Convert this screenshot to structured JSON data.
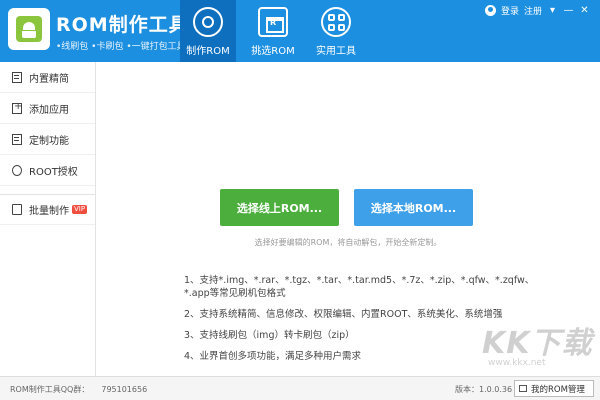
{
  "header": {
    "title": "ROM制作工具",
    "subtitle": "•线刷包 •卡刷包 •一键打包工具",
    "tabs": [
      {
        "label": "制作ROM",
        "icon": "gear-icon",
        "active": true
      },
      {
        "label": "挑选ROM",
        "icon": "store-icon",
        "active": false
      },
      {
        "label": "实用工具",
        "icon": "grid-icon",
        "active": false
      }
    ],
    "login": "登录",
    "register": "注册",
    "menu_glyph": "▾",
    "minimize_glyph": "—",
    "close_glyph": "✕"
  },
  "sidebar": {
    "items": [
      {
        "label": "内置精简",
        "icon": "document-icon"
      },
      {
        "label": "添加应用",
        "icon": "add-icon"
      },
      {
        "label": "定制功能",
        "icon": "customize-icon"
      },
      {
        "label": "ROOT授权",
        "icon": "root-icon"
      },
      {
        "label": "批量制作",
        "icon": "batch-icon",
        "badge": "VIP"
      }
    ]
  },
  "main": {
    "online_button": "选择线上ROM...",
    "local_button": "选择本地ROM...",
    "hint": "选择好要编辑的ROM，将自动解包，开始全新定制。",
    "features": [
      "1、支持*.img、*.rar、*.tgz、*.tar、*.tar.md5、*.7z、*.zip、*.qfw、*.zqfw、*.app等常见刷机包格式",
      "2、支持系统精简、信息修改、权限编辑、内置ROOT、系统美化、系统增强",
      "3、支持线刷包（img）转卡刷包（zip）",
      "4、业界首创多项功能，满足多种用户需求"
    ]
  },
  "footer": {
    "qq_label": "ROM制作工具QQ群：",
    "qq_number": "795101656",
    "version": "版本：1.0.0.36",
    "my_rom": "我的ROM管理"
  },
  "watermark": {
    "text": "KK下载",
    "sub": "www.kkx.net"
  },
  "colors": {
    "header": "#1d8fe0",
    "active_tab": "#0e6fbf",
    "online_button": "#4caf3d",
    "local_button": "#3fa0ea",
    "vip_badge": "#f04e3e"
  }
}
